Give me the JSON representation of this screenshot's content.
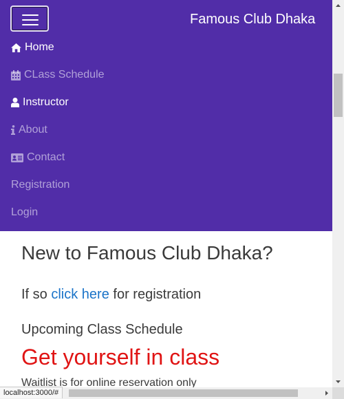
{
  "navbar": {
    "brand": "Famous Club Dhaka",
    "toggler_icon": "hamburger-menu-icon",
    "background": "#512da8",
    "items": [
      {
        "label": "Home",
        "icon": "home-icon",
        "active": true
      },
      {
        "label": "CLass Schedule",
        "icon": "calendar-icon",
        "active": false
      },
      {
        "label": "Instructor",
        "icon": "user-icon",
        "active": true
      },
      {
        "label": "About",
        "icon": "info-icon",
        "active": false
      },
      {
        "label": "Contact",
        "icon": "address-card-icon",
        "active": false
      },
      {
        "label": "Registration",
        "icon": "",
        "active": false
      },
      {
        "label": "Login",
        "icon": "",
        "active": false
      }
    ]
  },
  "main": {
    "heading": "New to Famous Club Dhaka?",
    "registration_prefix": "If so",
    "registration_link": "click here",
    "registration_suffix": "for registration",
    "upcoming_title": "Upcoming Class Schedule",
    "promo_title": "Get yourself in class",
    "waitlist_note": "Waitlist is for online reservation only"
  },
  "status_bar": {
    "url": "localhost:3000/#"
  },
  "colors": {
    "navbar": "#512da8",
    "link": "#1a73c8",
    "promo": "#e01414",
    "text": "#3a3a3a"
  }
}
